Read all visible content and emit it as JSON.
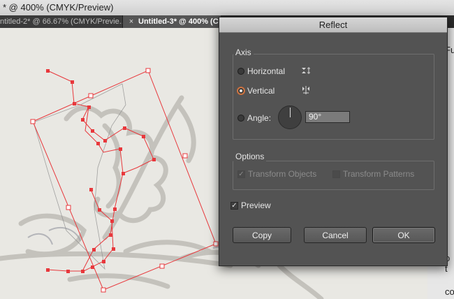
{
  "window": {
    "title_fragment": "* @ 400% (CMYK/Preview)"
  },
  "tabs": [
    {
      "label": "ntitled-2* @ 66.67% (CMYK/Previe...",
      "active": false
    },
    {
      "close_glyph": "×",
      "label": "Untitled-3* @ 400% (C",
      "active": true
    }
  ],
  "right_panel": {
    "fragments": [
      "Fu",
      "o t",
      "co"
    ]
  },
  "dialog": {
    "title": "Reflect",
    "axis": {
      "legend": "Axis",
      "horizontal_label": "Horizontal",
      "vertical_label": "Vertical",
      "angle_label": "Angle:",
      "angle_value": "90°",
      "selected": "Vertical"
    },
    "options": {
      "legend": "Options",
      "transform_objects_label": "Transform Objects",
      "transform_objects_checked": true,
      "transform_patterns_label": "Transform Patterns",
      "transform_patterns_checked": false
    },
    "preview": {
      "label": "Preview",
      "checked": true
    },
    "buttons": {
      "copy": "Copy",
      "cancel": "Cancel",
      "ok": "OK"
    }
  },
  "colors": {
    "selection": "#e8383c",
    "accent_radio": "#d9824b",
    "dialog_bg": "#535353"
  },
  "icons": [
    "reflect-horizontal-icon",
    "reflect-vertical-icon",
    "angle-dial-icon",
    "close-icon"
  ]
}
